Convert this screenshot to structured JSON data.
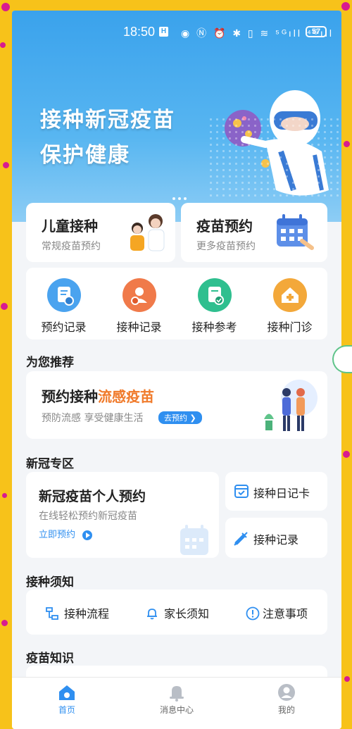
{
  "status": {
    "time": "18:50",
    "hd": "H",
    "icons": "◉ Ⓝ ⏰ ✱ ▯ ≋ ⁵ᴳıll ⁴ᴳıll",
    "battery": "57"
  },
  "hero": {
    "line1": "接种新冠疫苗",
    "line2": "保护健康"
  },
  "top_cards": {
    "children": {
      "title": "儿童接种",
      "subtitle": "常规疫苗预约"
    },
    "appointment": {
      "title": "疫苗预约",
      "subtitle": "更多疫苗预约"
    }
  },
  "quick_actions": [
    {
      "label": "预约记录",
      "color": "#4aa3ef",
      "icon": "document-clock-icon"
    },
    {
      "label": "接种记录",
      "color": "#f07a4a",
      "icon": "person-clock-icon"
    },
    {
      "label": "接种参考",
      "color": "#2fbf8f",
      "icon": "document-check-icon"
    },
    {
      "label": "接种门诊",
      "color": "#f3a83a",
      "icon": "clinic-house-icon"
    }
  ],
  "recommend": {
    "section_title": "为您推荐",
    "title_prefix": "预约接种",
    "title_highlight": "流感疫苗",
    "subtitle": "预防流感 享受健康生活",
    "button": "去预约 ❯"
  },
  "covid": {
    "section_title": "新冠专区",
    "main_title": "新冠疫苗个人预约",
    "main_subtitle": "在线轻松预约新冠疫苗",
    "main_link": "立即预约",
    "diary": "接种日记卡",
    "record": "接种记录"
  },
  "notice": {
    "section_title": "接种须知",
    "items": [
      "接种流程",
      "家长须知",
      "注意事项"
    ]
  },
  "knowledge": {
    "section_title": "疫苗知识"
  },
  "tabbar": [
    {
      "label": "首页",
      "active": true
    },
    {
      "label": "消息中心",
      "active": false
    },
    {
      "label": "我的",
      "active": false
    }
  ],
  "colors": {
    "primary": "#2f8ff0",
    "highlight": "#f07a2a",
    "frame": "#f7c21a",
    "confetti": "#d81b8f"
  }
}
